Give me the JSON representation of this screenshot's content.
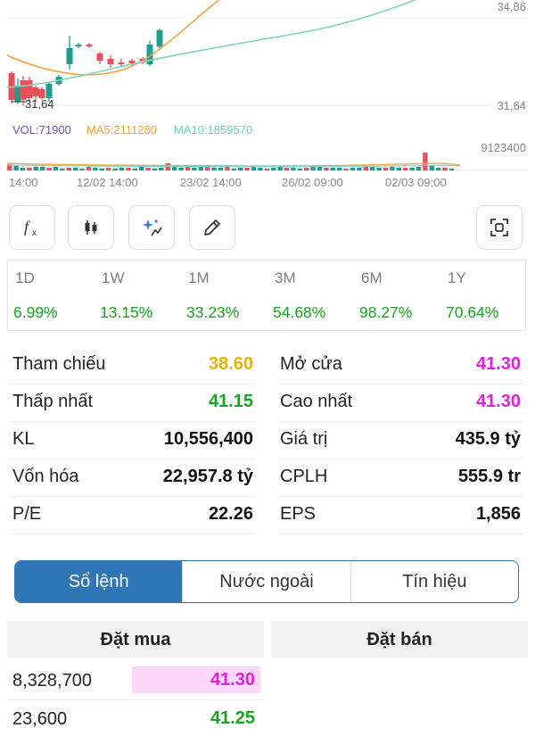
{
  "chart": {
    "price_top_label": "34,86",
    "price_bottom_label": "31,64",
    "min_marker": "31,64",
    "vol_label": "VOL:71900",
    "ma5_label": "MA5:2111280",
    "ma10_label": "MA10:1859570",
    "vol_axis_label": "9123400",
    "x_labels": [
      "14:00",
      "12/02 14:00",
      "23/02 14:00",
      "26/02 09:00",
      "02/03 09:00"
    ],
    "colors": {
      "up": "#1e9e8a",
      "down": "#e8505b",
      "ma5": "#f0a23b",
      "ma10": "#7fd3c4",
      "vol": "#7a4fbf"
    }
  },
  "toolbar": {
    "buttons": [
      "fx-icon",
      "candlestick-icon",
      "sparkle-magic-icon",
      "pencil-icon",
      "screenshot-frame-icon"
    ]
  },
  "performance": [
    {
      "label": "1D",
      "value": "6.99%"
    },
    {
      "label": "1W",
      "value": "13.15%"
    },
    {
      "label": "1M",
      "value": "33.23%"
    },
    {
      "label": "3M",
      "value": "54.68%"
    },
    {
      "label": "6M",
      "value": "98.27%"
    },
    {
      "label": "1Y",
      "value": "70.64%"
    }
  ],
  "stats": {
    "left": [
      {
        "label": "Tham chiếu",
        "value": "38.60",
        "color": "#e6b200"
      },
      {
        "label": "Thấp nhất",
        "value": "41.15",
        "color": "#18a51d"
      },
      {
        "label": "KL",
        "value": "10,556,400",
        "color": "#111111"
      },
      {
        "label": "Vốn hóa",
        "value": "22,957.8 tỷ",
        "color": "#111111"
      },
      {
        "label": "P/E",
        "value": "22.26",
        "color": "#111111"
      }
    ],
    "right": [
      {
        "label": "Mở cửa",
        "value": "41.30",
        "color": "#e020e0"
      },
      {
        "label": "Cao nhất",
        "value": "41.30",
        "color": "#e020e0"
      },
      {
        "label": "Giá trị",
        "value": "435.9 tỷ",
        "color": "#111111"
      },
      {
        "label": "CPLH",
        "value": "555.9 tr",
        "color": "#111111"
      },
      {
        "label": "EPS",
        "value": "1,856",
        "color": "#111111"
      }
    ]
  },
  "tabs": [
    {
      "label": "Sổ lệnh",
      "active": true
    },
    {
      "label": "Nước ngoài",
      "active": false
    },
    {
      "label": "Tín hiệu",
      "active": false
    }
  ],
  "orderbook": {
    "buy_header": "Đặt mua",
    "sell_header": "Đặt bán",
    "buy_rows": [
      {
        "volume": "8,328,700",
        "price": "41.30",
        "color": "#e020e0",
        "bg": "#ffd6fb"
      },
      {
        "volume": "23,600",
        "price": "41.25",
        "color": "#18a51d",
        "bg": ""
      }
    ]
  }
}
